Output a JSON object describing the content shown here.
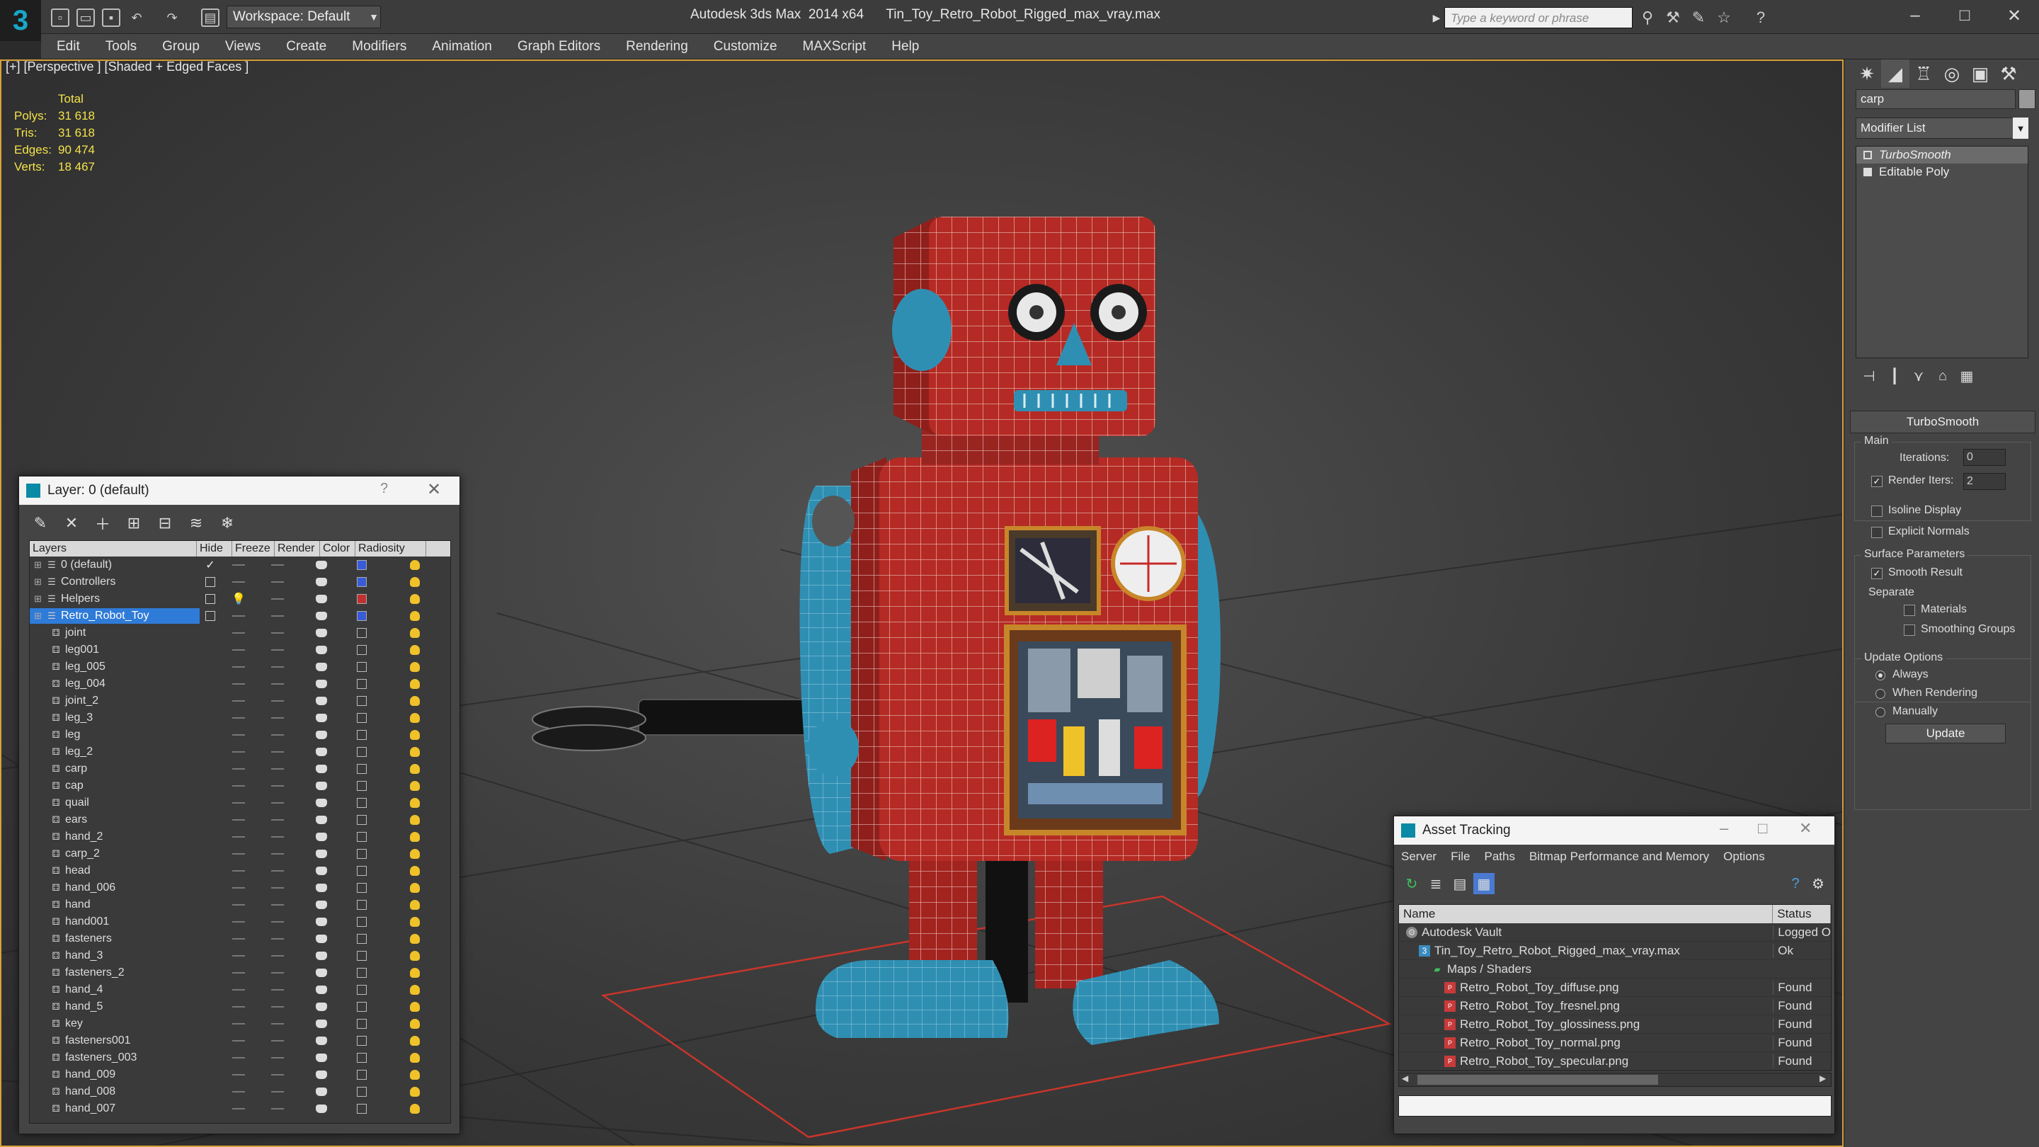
{
  "titlebar": {
    "workspace": "Workspace: Default",
    "app_title": "Autodesk 3ds Max  2014 x64      Tin_Toy_Retro_Robot_Rigged_max_vray.max",
    "search_placeholder": "Type a keyword or phrase"
  },
  "menu": [
    "Edit",
    "Tools",
    "Group",
    "Views",
    "Create",
    "Modifiers",
    "Animation",
    "Graph Editors",
    "Rendering",
    "Customize",
    "MAXScript",
    "Help"
  ],
  "viewport": {
    "label": "[+] [Perspective ] [Shaded + Edged Faces ]",
    "stats_header": "Total",
    "stats": [
      {
        "label": "Polys:",
        "value": "31 618"
      },
      {
        "label": "Tris:",
        "value": "31 618"
      },
      {
        "label": "Edges:",
        "value": "90 474"
      },
      {
        "label": "Verts:",
        "value": "18 467"
      }
    ]
  },
  "command_panel": {
    "object_name": "carp",
    "modifier_list": "Modifier List",
    "stack": [
      "TurboSmooth",
      "Editable Poly"
    ],
    "rollout_title": "TurboSmooth",
    "main_group": "Main",
    "iterations_label": "Iterations:",
    "iterations_value": "0",
    "render_iters_label": "Render Iters:",
    "render_iters_value": "2",
    "isoline_label": "Isoline Display",
    "explicit_normals_label": "Explicit Normals",
    "surface_group": "Surface Parameters",
    "smooth_result_label": "Smooth Result",
    "separate_label": "Separate",
    "materials_label": "Materials",
    "smoothing_groups_label": "Smoothing Groups",
    "update_group": "Update Options",
    "always_label": "Always",
    "when_rendering_label": "When Rendering",
    "manually_label": "Manually",
    "update_button": "Update"
  },
  "layer_dialog": {
    "title": "Layer: 0 (default)",
    "help": "?",
    "columns": [
      "Layers",
      "Hide",
      "Freeze",
      "Render",
      "Color",
      "Radiosity"
    ],
    "layers": [
      {
        "name": "0 (default)",
        "type": "layer",
        "current": true,
        "color": "#3a5bd8",
        "hide": "dash"
      },
      {
        "name": "Controllers",
        "type": "layer",
        "current": false,
        "color": "#3a5bd8",
        "hide": "dash"
      },
      {
        "name": "Helpers",
        "type": "layer",
        "current": false,
        "color": "#c03030",
        "hide": "bulb"
      },
      {
        "name": "Retro_Robot_Toy",
        "type": "layer",
        "current": false,
        "color": "#3a5bd8",
        "hide": "dash",
        "selected": true
      },
      {
        "name": "joint",
        "type": "object"
      },
      {
        "name": "leg001",
        "type": "object"
      },
      {
        "name": "leg_005",
        "type": "object"
      },
      {
        "name": "leg_004",
        "type": "object"
      },
      {
        "name": "joint_2",
        "type": "object"
      },
      {
        "name": "leg_3",
        "type": "object"
      },
      {
        "name": "leg",
        "type": "object"
      },
      {
        "name": "leg_2",
        "type": "object"
      },
      {
        "name": "carp",
        "type": "object"
      },
      {
        "name": "cap",
        "type": "object"
      },
      {
        "name": "quail",
        "type": "object"
      },
      {
        "name": "ears",
        "type": "object"
      },
      {
        "name": "hand_2",
        "type": "object"
      },
      {
        "name": "carp_2",
        "type": "object"
      },
      {
        "name": "head",
        "type": "object"
      },
      {
        "name": "hand_006",
        "type": "object"
      },
      {
        "name": "hand",
        "type": "object"
      },
      {
        "name": "hand001",
        "type": "object"
      },
      {
        "name": "fasteners",
        "type": "object"
      },
      {
        "name": "hand_3",
        "type": "object"
      },
      {
        "name": "fasteners_2",
        "type": "object"
      },
      {
        "name": "hand_4",
        "type": "object"
      },
      {
        "name": "hand_5",
        "type": "object"
      },
      {
        "name": "key",
        "type": "object"
      },
      {
        "name": "fasteners001",
        "type": "object"
      },
      {
        "name": "fasteners_003",
        "type": "object"
      },
      {
        "name": "hand_009",
        "type": "object"
      },
      {
        "name": "hand_008",
        "type": "object"
      },
      {
        "name": "hand_007",
        "type": "object"
      }
    ]
  },
  "asset_dialog": {
    "title": "Asset Tracking",
    "menu": [
      "Server",
      "File",
      "Paths",
      "Bitmap Performance and Memory",
      "Options"
    ],
    "columns": [
      "Name",
      "Status"
    ],
    "rows": [
      {
        "name": "Autodesk Vault",
        "status": "Logged O",
        "level": 0,
        "icon": "vault"
      },
      {
        "name": "Tin_Toy_Retro_Robot_Rigged_max_vray.max",
        "status": "Ok",
        "level": 1,
        "icon": "max"
      },
      {
        "name": "Maps / Shaders",
        "status": "",
        "level": 2,
        "icon": "folder"
      },
      {
        "name": "Retro_Robot_Toy_diffuse.png",
        "status": "Found",
        "level": 3,
        "icon": "png"
      },
      {
        "name": "Retro_Robot_Toy_fresnel.png",
        "status": "Found",
        "level": 3,
        "icon": "png"
      },
      {
        "name": "Retro_Robot_Toy_glossiness.png",
        "status": "Found",
        "level": 3,
        "icon": "png"
      },
      {
        "name": "Retro_Robot_Toy_normal.png",
        "status": "Found",
        "level": 3,
        "icon": "png"
      },
      {
        "name": "Retro_Robot_Toy_specular.png",
        "status": "Found",
        "level": 3,
        "icon": "png"
      }
    ]
  },
  "colors": {
    "robot_red": "#b52a24",
    "robot_blue": "#2f8fb3",
    "selection_blue": "#2f7bd8",
    "stats_yellow": "#f4e24a",
    "viewport_border": "#d8a13a"
  }
}
